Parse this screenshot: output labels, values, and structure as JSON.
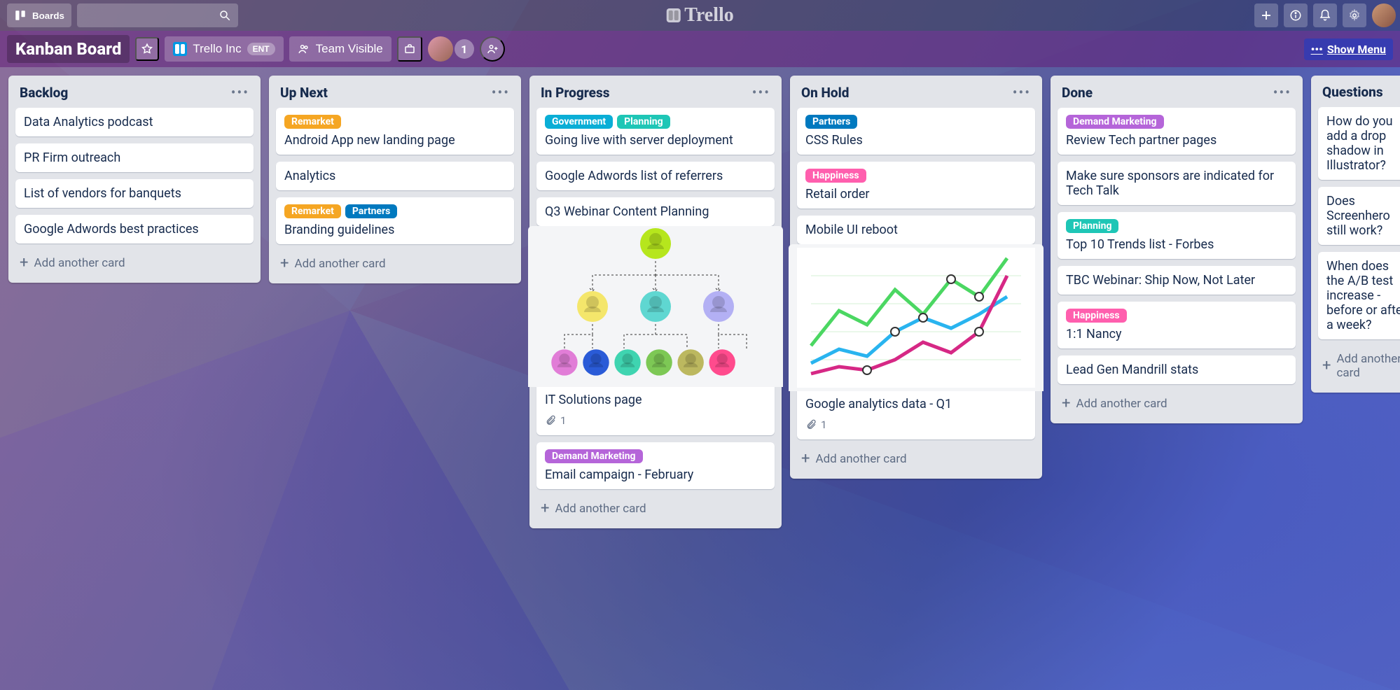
{
  "topbar": {
    "boards_label": "Boards",
    "logo_text": "Trello"
  },
  "boardbar": {
    "title": "Kanban Board",
    "org": "Trello Inc",
    "org_badge": "ENT",
    "visibility": "Team Visible",
    "member_count": "1",
    "show_menu": "Show Menu"
  },
  "labels": {
    "remarket": "Remarket",
    "partners": "Partners",
    "government": "Government",
    "planning": "Planning",
    "happiness": "Happiness",
    "demand_marketing": "Demand Marketing"
  },
  "add_card": "Add another card",
  "lists": {
    "backlog": {
      "title": "Backlog",
      "cards": [
        "Data Analytics podcast",
        "PR Firm outreach",
        "List of vendors for banquets",
        "Google Adwords best practices"
      ]
    },
    "upnext": {
      "title": "Up Next",
      "c0": "Android App new landing page",
      "c1": "Analytics",
      "c2": "Branding guidelines"
    },
    "inprogress": {
      "title": "In Progress",
      "c0": "Going live with server deployment",
      "c1": "Google Adwords list of referrers",
      "c2": "Q3 Webinar Content Planning",
      "c3": "IT Solutions page",
      "c3_attach": "1",
      "c4": "Email campaign - February"
    },
    "onhold": {
      "title": "On Hold",
      "c0": "CSS Rules",
      "c1": "Retail order",
      "c2": "Mobile UI reboot",
      "c3": "Google analytics data - Q1",
      "c3_attach": "1"
    },
    "done": {
      "title": "Done",
      "c0": "Review Tech partner pages",
      "c1": "Make sure sponsors are indicated for Tech Talk",
      "c2": "Top 10 Trends list - Forbes",
      "c3": "TBC Webinar: Ship Now, Not Later",
      "c4": "1:1 Nancy",
      "c5": "Lead Gen Mandrill stats"
    },
    "questions": {
      "title": "Questions",
      "c0": "How do you add a drop shadow in Illustrator?",
      "c1": "Does Screenhero still work?",
      "c2": "When does the A/B test increase - before or after a week?"
    }
  }
}
